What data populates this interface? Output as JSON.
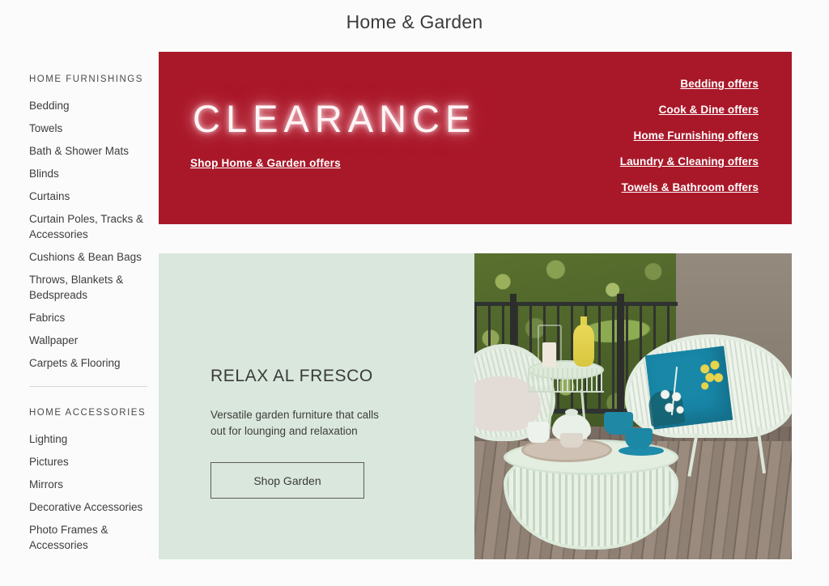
{
  "header": {
    "title": "Home & Garden"
  },
  "sidebar": {
    "groups": [
      {
        "title": "HOME FURNISHINGS",
        "items": [
          "Bedding",
          "Towels",
          "Bath & Shower Mats",
          "Blinds",
          "Curtains",
          "Curtain Poles, Tracks & Accessories",
          "Cushions & Bean Bags",
          "Throws, Blankets & Bedspreads",
          "Fabrics",
          "Wallpaper",
          "Carpets & Flooring"
        ]
      },
      {
        "title": "HOME ACCESSORIES",
        "items": [
          "Lighting",
          "Pictures",
          "Mirrors",
          "Decorative Accessories",
          "Photo Frames & Accessories"
        ]
      }
    ]
  },
  "banner": {
    "headline": "CLEARANCE",
    "cta": "Shop Home & Garden offers",
    "background_color": "#A91829",
    "offer_links": [
      "Bedding offers",
      "Cook & Dine offers",
      "Home Furnishing offers",
      "Laundry & Cleaning offers",
      "Towels & Bathroom offers"
    ]
  },
  "promo": {
    "heading": "RELAX AL FRESCO",
    "subtext": "Versatile garden furniture that calls out for lounging and relaxation",
    "button_label": "Shop Garden",
    "background_color": "#D9E7DC",
    "image_alt": "Garden patio with mint woven chairs, round woven coffee table, teal cushion and tea set on decking"
  }
}
